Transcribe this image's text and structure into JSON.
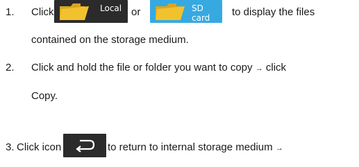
{
  "steps": [
    {
      "number": "1.",
      "pre": "Click",
      "mid": "or",
      "post": "to display the files",
      "cont": "contained on the storage  medium.",
      "buttons": {
        "local_label": "Local",
        "sd_label": "SD card"
      }
    },
    {
      "number": "2.",
      "line1": "Click and hold the file or folder you want to copy",
      "arrow": "→",
      "line1_end": "click",
      "cont": "Copy."
    },
    {
      "number": "3.",
      "pre": "Click icon",
      "post": "to return to internal storage medium",
      "arrow": "→"
    }
  ],
  "icons": {
    "folder": "folder-icon",
    "back": "back-arrow-icon"
  },
  "colors": {
    "text": "#1a1a1a",
    "local_button_bg": "#2b2b2b",
    "sd_button_bg": "#36a9e1",
    "folder_yellow": "#f2c12e",
    "button_text": "#ffffff"
  }
}
